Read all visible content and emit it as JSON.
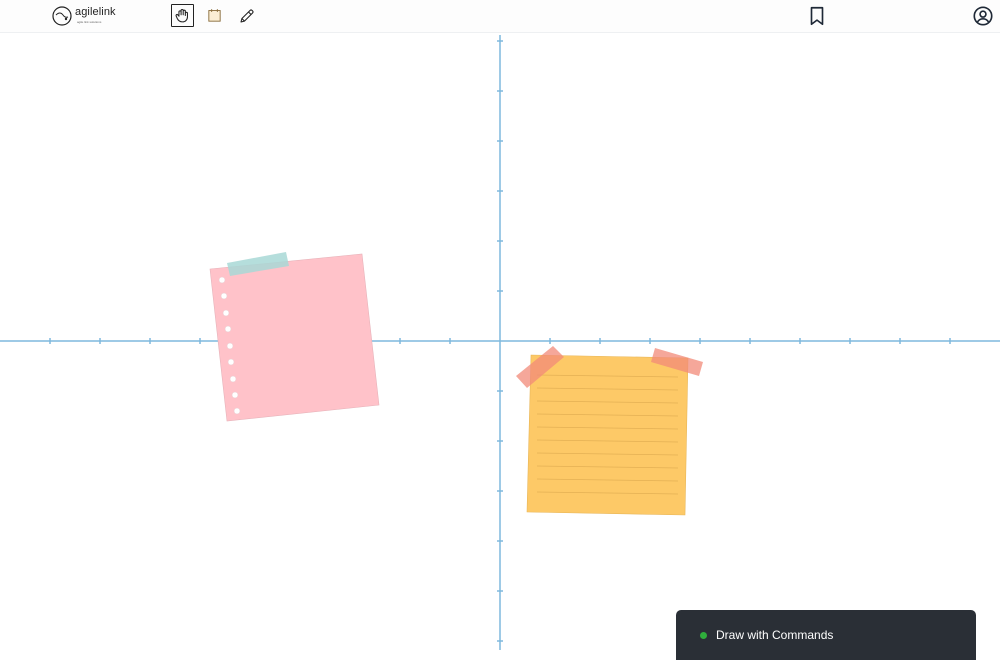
{
  "app": {
    "logo_text": "agilelink",
    "logo_sub": "agile link solutions"
  },
  "toolbar": {
    "tools": [
      {
        "icon": "hand-icon",
        "active": true
      },
      {
        "icon": "sticky-note-icon",
        "active": false
      },
      {
        "icon": "pencil-icon",
        "active": false
      }
    ],
    "right_icons": [
      "bookmark-icon",
      "account-icon"
    ]
  },
  "canvas": {
    "axis_color": "#7fb9dd",
    "notes": [
      {
        "kind": "pink-notebook-note",
        "color": "#ffc2c9",
        "tape_color": "#a8d8d6"
      },
      {
        "kind": "yellow-lined-note",
        "color": "#fdc967",
        "tape_color": "#f28a78"
      }
    ]
  },
  "toast": {
    "label": "Draw with Commands",
    "status_color": "#2fae3c"
  }
}
